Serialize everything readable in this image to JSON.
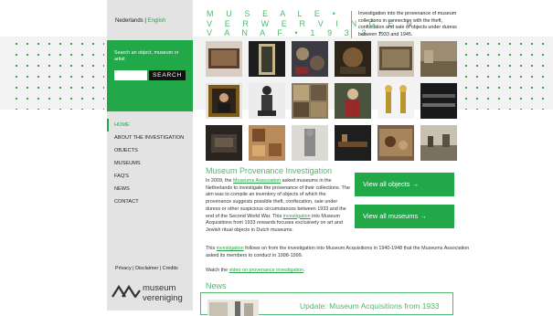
{
  "header": {
    "title_line1": "M U S E A L E  •",
    "title_line2": "V E R W E R V I N G E N",
    "title_line3": "V A N A F • 1 9 3 3 •",
    "intro": "Investigation into the provenance of museum collections in connection with the theft, confiscation and sale of objects under duress between 1933 and 1945."
  },
  "sidebar": {
    "lang_nl": "Nederlands",
    "lang_sep": " | ",
    "lang_en": "English",
    "search_hint": "Search an object, museum or artist",
    "search_input_value": "",
    "search_button": "SEARCH",
    "nav": [
      {
        "label": "HOME",
        "active": true
      },
      {
        "label": "ABOUT THE INVESTIGATION",
        "active": false
      },
      {
        "label": "OBJECTS",
        "active": false
      },
      {
        "label": "MUSEUMS",
        "active": false
      },
      {
        "label": "FAQ'S",
        "active": false
      },
      {
        "label": "NEWS",
        "active": false
      },
      {
        "label": "CONTACT",
        "active": false
      }
    ],
    "footer_privacy": "Privacy",
    "footer_disclaimer": "Disclaimer",
    "footer_credits": "Credits",
    "footer_sep": " | ",
    "logo_word1": "museum",
    "logo_word2": "vereniging"
  },
  "about": {
    "title": "Museum Provenance Investigation",
    "text_part1": "In 2009, the ",
    "link_museums_association": "Museums Association",
    "text_part2": " asked museums in the Netherlands to investigate the provenance of their collections. The aim was to compile an inventory of objects of which the provenance suggests possible theft, confiscation, sale under duress or other suspicious circumstances between 1933 and the end of the Second World War. This ",
    "link_investigation": "investigation",
    "text_part3": " into Museum Acquisitions from 1933 onwards focuses exclusively on art and Jewish ritual objects in Dutch museums.",
    "btn_objects": "View all objects →",
    "btn_museums": "View all museums →",
    "followup_part1": "This ",
    "followup_link": "investigation",
    "followup_part2": " follows on from the investigation into Museum Acquisitions in 1940-1948 that the Museums Association asked its members to conduct in 1998-1999.",
    "watch_part1": "Watch the ",
    "watch_link": "video on provenance investigation",
    "watch_part2": "."
  },
  "news": {
    "title": "News",
    "headline": "Update: Museum Acquisitions from 1933"
  },
  "colors": {
    "accent": "#20a849",
    "title_green": "#4dbb6a",
    "sidebar_bg": "#e3e3e3"
  }
}
